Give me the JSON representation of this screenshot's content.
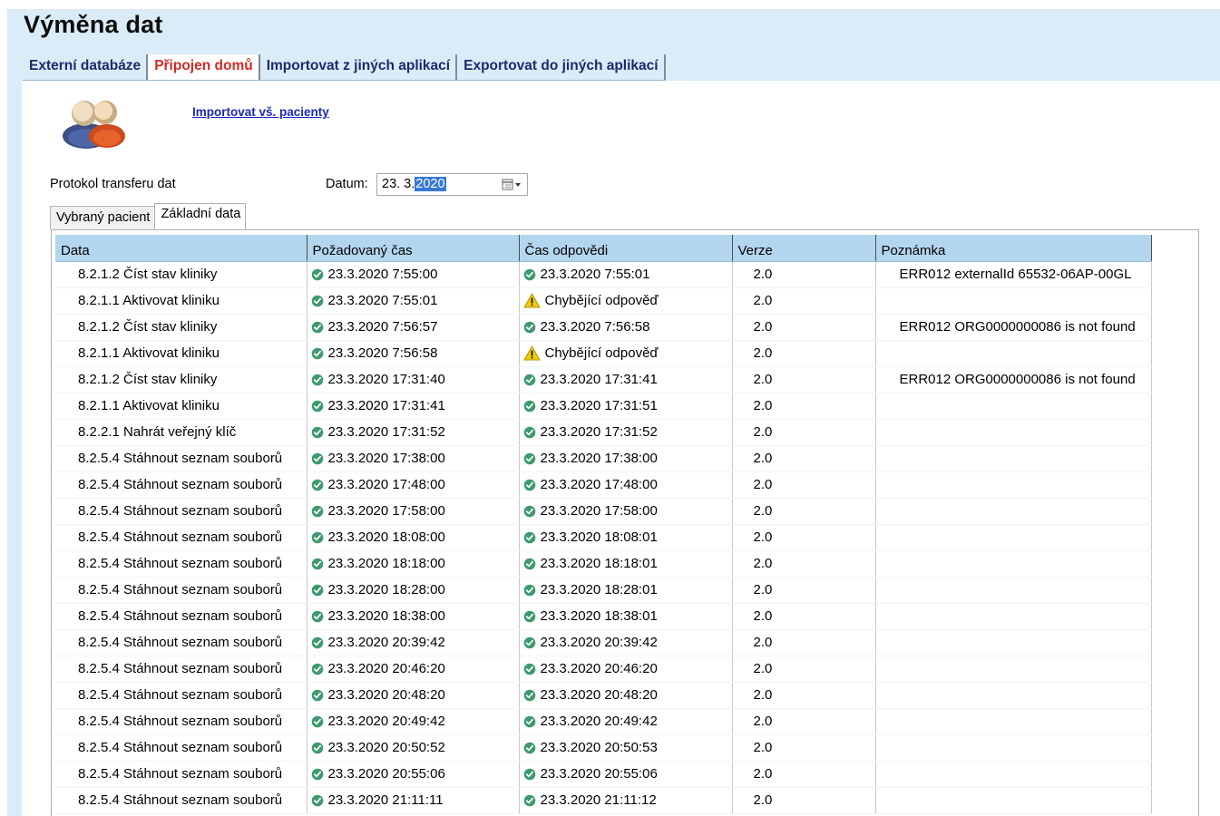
{
  "page": {
    "title": "Výměna dat"
  },
  "top_tabs": [
    {
      "label": "Externí databáze",
      "active": false
    },
    {
      "label": "Připojen domů",
      "active": true
    },
    {
      "label": "Importovat z jiných aplikací",
      "active": false
    },
    {
      "label": "Exportovat do jiných aplikací",
      "active": false
    }
  ],
  "import_link": "Importovat vš. pacienty",
  "protocol_label": "Protokol transferu dat",
  "date": {
    "label": "Datum:",
    "value_prefix": "23.  3.",
    "value_selected": "2020"
  },
  "sub_tabs": [
    {
      "label": "Vybraný pacient",
      "active": false
    },
    {
      "label": "Základní data",
      "active": true
    }
  ],
  "table": {
    "columns": [
      "Data",
      "Požadovaný čas",
      "Čas odpovědi",
      "Verze",
      "Poznámka"
    ],
    "rows": [
      {
        "data": "8.2.1.2 Číst stav kliniky",
        "request": "23.3.2020 7:55:00",
        "response": "23.3.2020 7:55:01",
        "response_status": "ok",
        "version": "2.0",
        "note": "ERR012 externalId 65532-06AP-00GL"
      },
      {
        "data": "8.2.1.1 Aktivovat kliniku",
        "request": "23.3.2020 7:55:01",
        "response": "Chybějící odpověď",
        "response_status": "warning",
        "version": "2.0",
        "note": ""
      },
      {
        "data": "8.2.1.2 Číst stav kliniky",
        "request": "23.3.2020 7:56:57",
        "response": "23.3.2020 7:56:58",
        "response_status": "ok",
        "version": "2.0",
        "note": "ERR012 ORG0000000086 is not found"
      },
      {
        "data": "8.2.1.1 Aktivovat kliniku",
        "request": "23.3.2020 7:56:58",
        "response": "Chybějící odpověď",
        "response_status": "warning",
        "version": "2.0",
        "note": ""
      },
      {
        "data": "8.2.1.2 Číst stav kliniky",
        "request": "23.3.2020 17:31:40",
        "response": "23.3.2020 17:31:41",
        "response_status": "ok",
        "version": "2.0",
        "note": "ERR012 ORG0000000086 is not found"
      },
      {
        "data": "8.2.1.1 Aktivovat kliniku",
        "request": "23.3.2020 17:31:41",
        "response": "23.3.2020 17:31:51",
        "response_status": "ok",
        "version": "2.0",
        "note": ""
      },
      {
        "data": "8.2.2.1 Nahrát veřejný klíč",
        "request": "23.3.2020 17:31:52",
        "response": "23.3.2020 17:31:52",
        "response_status": "ok",
        "version": "2.0",
        "note": ""
      },
      {
        "data": "8.2.5.4 Stáhnout seznam souborů",
        "request": "23.3.2020 17:38:00",
        "response": "23.3.2020 17:38:00",
        "response_status": "ok",
        "version": "2.0",
        "note": ""
      },
      {
        "data": "8.2.5.4 Stáhnout seznam souborů",
        "request": "23.3.2020 17:48:00",
        "response": "23.3.2020 17:48:00",
        "response_status": "ok",
        "version": "2.0",
        "note": ""
      },
      {
        "data": "8.2.5.4 Stáhnout seznam souborů",
        "request": "23.3.2020 17:58:00",
        "response": "23.3.2020 17:58:00",
        "response_status": "ok",
        "version": "2.0",
        "note": ""
      },
      {
        "data": "8.2.5.4 Stáhnout seznam souborů",
        "request": "23.3.2020 18:08:00",
        "response": "23.3.2020 18:08:01",
        "response_status": "ok",
        "version": "2.0",
        "note": ""
      },
      {
        "data": "8.2.5.4 Stáhnout seznam souborů",
        "request": "23.3.2020 18:18:00",
        "response": "23.3.2020 18:18:01",
        "response_status": "ok",
        "version": "2.0",
        "note": ""
      },
      {
        "data": "8.2.5.4 Stáhnout seznam souborů",
        "request": "23.3.2020 18:28:00",
        "response": "23.3.2020 18:28:01",
        "response_status": "ok",
        "version": "2.0",
        "note": ""
      },
      {
        "data": "8.2.5.4 Stáhnout seznam souborů",
        "request": "23.3.2020 18:38:00",
        "response": "23.3.2020 18:38:01",
        "response_status": "ok",
        "version": "2.0",
        "note": ""
      },
      {
        "data": "8.2.5.4 Stáhnout seznam souborů",
        "request": "23.3.2020 20:39:42",
        "response": "23.3.2020 20:39:42",
        "response_status": "ok",
        "version": "2.0",
        "note": ""
      },
      {
        "data": "8.2.5.4 Stáhnout seznam souborů",
        "request": "23.3.2020 20:46:20",
        "response": "23.3.2020 20:46:20",
        "response_status": "ok",
        "version": "2.0",
        "note": ""
      },
      {
        "data": "8.2.5.4 Stáhnout seznam souborů",
        "request": "23.3.2020 20:48:20",
        "response": "23.3.2020 20:48:20",
        "response_status": "ok",
        "version": "2.0",
        "note": ""
      },
      {
        "data": "8.2.5.4 Stáhnout seznam souborů",
        "request": "23.3.2020 20:49:42",
        "response": "23.3.2020 20:49:42",
        "response_status": "ok",
        "version": "2.0",
        "note": ""
      },
      {
        "data": "8.2.5.4 Stáhnout seznam souborů",
        "request": "23.3.2020 20:50:52",
        "response": "23.3.2020 20:50:53",
        "response_status": "ok",
        "version": "2.0",
        "note": ""
      },
      {
        "data": "8.2.5.4 Stáhnout seznam souborů",
        "request": "23.3.2020 20:55:06",
        "response": "23.3.2020 20:55:06",
        "response_status": "ok",
        "version": "2.0",
        "note": ""
      },
      {
        "data": "8.2.5.4 Stáhnout seznam souborů",
        "request": "23.3.2020 21:11:11",
        "response": "23.3.2020 21:11:12",
        "response_status": "ok",
        "version": "2.0",
        "note": ""
      }
    ]
  },
  "icons": {
    "avatar": "patients-group-icon",
    "calendar": "calendar-dropdown-icon",
    "ok": "check-circle-icon",
    "warning": "warning-triangle-icon"
  },
  "colors": {
    "page_background": "#d9ecf7",
    "active_tab_text": "#cf2a24",
    "tab_text": "#1d2a6c",
    "link": "#1a29b8",
    "header_background": "#b3d6ef",
    "ok_icon": "#3e9a6e",
    "warning_icon": "#f1cc00"
  }
}
